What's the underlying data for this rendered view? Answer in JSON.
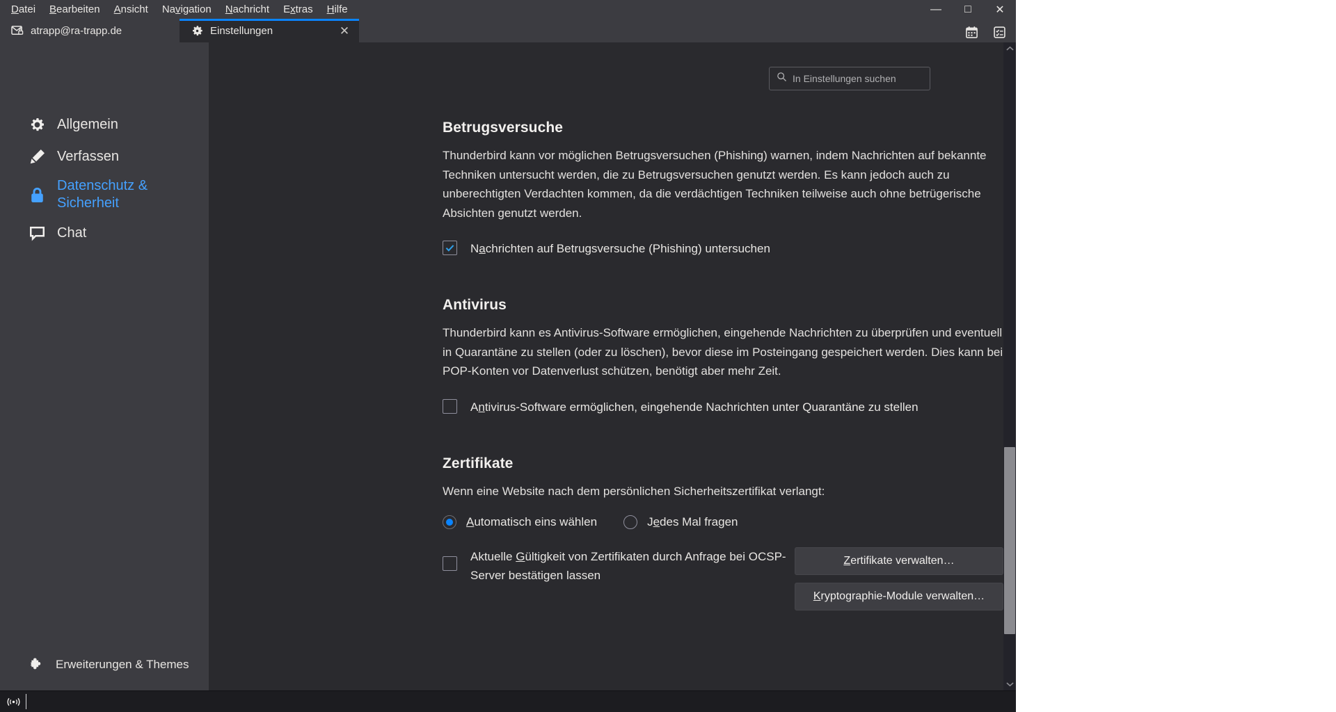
{
  "window": {
    "menubar": [
      {
        "label": "Datei",
        "accesskey": "D"
      },
      {
        "label": "Bearbeiten",
        "accesskey": "B"
      },
      {
        "label": "Ansicht",
        "accesskey": "A"
      },
      {
        "label": "Navigation",
        "accesskey": "v"
      },
      {
        "label": "Nachricht",
        "accesskey": "N"
      },
      {
        "label": "Extras",
        "accesskey": "x"
      },
      {
        "label": "Hilfe",
        "accesskey": "H"
      }
    ],
    "controls": {
      "minimize": "—",
      "maximize": "□",
      "close": "✕"
    },
    "toolbar_icons": [
      {
        "name": "calendar-icon"
      },
      {
        "name": "tasks-icon"
      }
    ]
  },
  "tabs": [
    {
      "label": "atrapp@ra-trapp.de",
      "icon": "mail-lock-icon",
      "active": false,
      "closable": false
    },
    {
      "label": "Einstellungen",
      "icon": "gear-icon",
      "active": true,
      "closable": true,
      "close_glyph": "✕"
    }
  ],
  "sidebar": {
    "items": [
      {
        "label": "Allgemein",
        "icon": "gear-icon",
        "active": false
      },
      {
        "label": "Verfassen",
        "icon": "pencil-icon",
        "active": false
      },
      {
        "label": "Datenschutz & Sicherheit",
        "icon": "lock-icon",
        "active": true
      },
      {
        "label": "Chat",
        "icon": "chat-bubble-icon",
        "active": false
      }
    ],
    "footer": {
      "label": "Erweiterungen & Themes",
      "icon": "puzzle-piece-icon"
    }
  },
  "search": {
    "placeholder": "In Einstellungen suchen",
    "value": "",
    "icon": "search-icon"
  },
  "sections": [
    {
      "id": "betrugsversuche",
      "title": "Betrugsversuche",
      "description": "Thunderbird kann vor möglichen Betrugsversuchen (Phishing) warnen, indem Nachrichten auf bekannte Techniken untersucht werden, die zu Betrugsversuchen genutzt werden. Es kann jedoch auch zu unberechtigten Verdachten kommen, da die verdächtigen Techniken teilweise auch ohne betrügerische Absichten genutzt werden.",
      "checkbox": {
        "label_before": "N",
        "label_key": "a",
        "label_after": "chrichten auf Betrugsversuche (Phishing) untersuchen",
        "checked": true
      }
    },
    {
      "id": "antivirus",
      "title": "Antivirus",
      "description": "Thunderbird kann es Antivirus-Software ermöglichen, eingehende Nachrichten zu überprüfen und eventuell in Quarantäne zu stellen (oder zu löschen), bevor diese im Posteingang gespeichert werden. Dies kann bei POP-Konten vor Datenverlust schützen, benötigt aber mehr Zeit.",
      "checkbox": {
        "label_before": "A",
        "label_key": "n",
        "label_after": "tivirus-Software ermöglichen, eingehende Nachrichten unter Quarantäne zu stellen",
        "checked": false
      }
    },
    {
      "id": "zertifikate",
      "title": "Zertifikate",
      "description": "Wenn eine Website nach dem persönlichen Sicherheitszertifikat verlangt:",
      "radios": [
        {
          "before": "",
          "key": "A",
          "after": "utomatisch eins wählen",
          "selected": true
        },
        {
          "before": "J",
          "key": "e",
          "after": "des Mal fragen",
          "selected": false
        }
      ],
      "ocsp": {
        "before": "Aktuelle ",
        "key": "G",
        "after": "ültigkeit von Zertifikaten durch Anfrage bei OCSP-Server bestätigen lassen",
        "checked": false
      },
      "buttons": [
        {
          "before": "",
          "key": "Z",
          "after": "ertifikate verwalten…"
        },
        {
          "before": "",
          "key": "K",
          "after": "ryptographie-Module verwalten…"
        }
      ]
    }
  ],
  "scrollbar": {
    "up_glyph": "⌃",
    "down_glyph": "⌄",
    "thumb_top_pct": 63,
    "thumb_height_pct": 30
  },
  "statusbar": {
    "icon": "broadcast-signal-icon",
    "text": ""
  },
  "colors": {
    "accent": "#0a84ff",
    "sidebar_bg": "#3c3c41",
    "content_bg": "#2a2a2e",
    "active_nav": "#45a1ff"
  }
}
